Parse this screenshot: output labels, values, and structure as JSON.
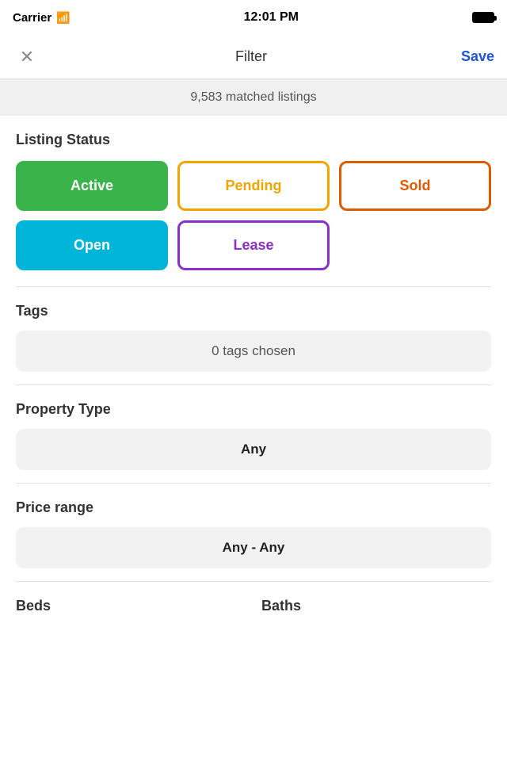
{
  "statusBar": {
    "carrier": "Carrier",
    "wifi": "wifi-icon",
    "time": "12:01 PM",
    "battery": "battery-icon"
  },
  "navBar": {
    "closeLabel": "✕",
    "title": "Filter",
    "saveLabel": "Save"
  },
  "matchBanner": {
    "text": "9,583 matched listings"
  },
  "listingStatus": {
    "sectionTitle": "Listing Status",
    "buttons": [
      {
        "label": "Active",
        "style": "active-selected"
      },
      {
        "label": "Pending",
        "style": "pending-outline"
      },
      {
        "label": "Sold",
        "style": "sold-outline"
      },
      {
        "label": "Open",
        "style": "open-selected"
      },
      {
        "label": "Lease",
        "style": "lease-outline"
      }
    ]
  },
  "tags": {
    "sectionTitle": "Tags",
    "pickerText": "0 tags chosen"
  },
  "propertyType": {
    "sectionTitle": "Property Type",
    "pickerText": "Any"
  },
  "priceRange": {
    "sectionTitle": "Price range",
    "pickerText": "Any - Any"
  },
  "bedsSection": {
    "title": "Beds"
  },
  "bathsSection": {
    "title": "Baths"
  }
}
